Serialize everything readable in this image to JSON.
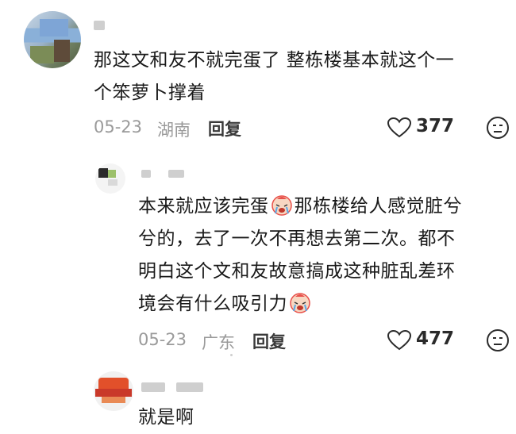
{
  "comments": [
    {
      "lines": [
        "那这文和友不就完蛋了 整栋楼基本就这个一",
        "个笨萝卜撑着"
      ],
      "date": "05-23",
      "location": "湖南",
      "reply_label": "回复",
      "likes": "377"
    },
    {
      "lines_parts": [
        [
          "本来就应该完蛋",
          "那栋楼给人感觉脏兮"
        ],
        [
          "兮的，去了一次不再想去第二次。都不"
        ],
        [
          "明白这个文和友故意搞成这种脏乱差环"
        ],
        [
          "境会有什么吸引力"
        ]
      ],
      "emoji": "crying-face-emoji",
      "date": "05-23",
      "location": "广东",
      "reply_label": "回复",
      "likes": "477"
    },
    {
      "text": "就是啊"
    }
  ],
  "colors": {
    "meta": "#9a9a9a",
    "text": "#1a1a1a",
    "emoji_red": "#e8504a"
  }
}
